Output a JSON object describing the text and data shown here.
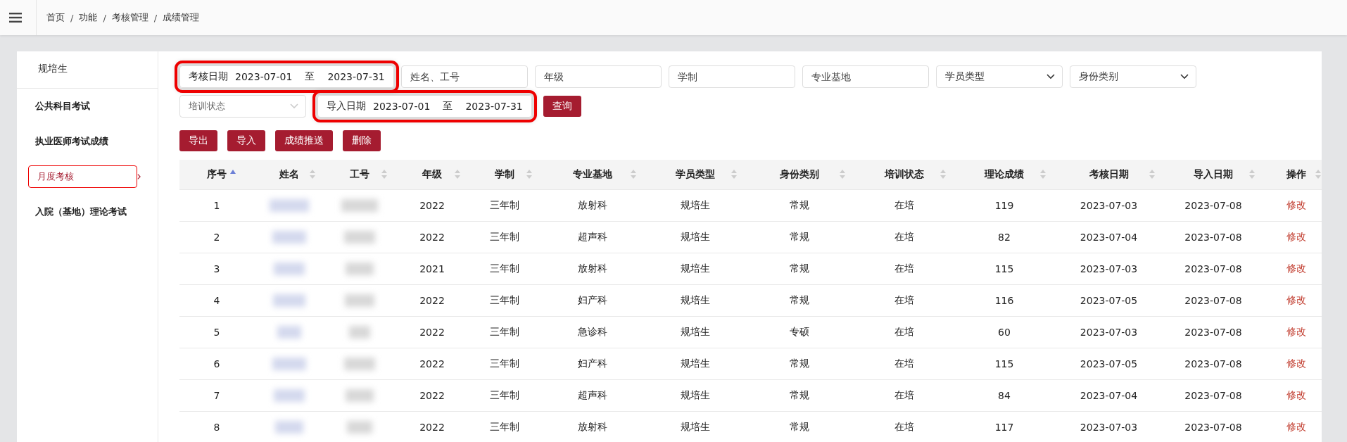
{
  "breadcrumb": [
    {
      "kind": "link",
      "text": "首页"
    },
    {
      "kind": "separator",
      "text": "/"
    },
    {
      "kind": "link",
      "text": "功能"
    },
    {
      "kind": "separator",
      "text": "/"
    },
    {
      "kind": "link",
      "text": "考核管理"
    },
    {
      "kind": "separator",
      "text": "/"
    },
    {
      "kind": "current",
      "text": "成绩管理"
    }
  ],
  "sidebar": {
    "title": "规培生",
    "items": [
      {
        "label": "公共科目考试",
        "selected": false,
        "highlighted": false
      },
      {
        "label": "执业医师考试成绩",
        "selected": false,
        "highlighted": false
      },
      {
        "label": "月度考核",
        "selected": true,
        "highlighted": true
      },
      {
        "label": "入院（基地）理论考试",
        "selected": false,
        "highlighted": false
      }
    ]
  },
  "filters": [
    {
      "kind": "range",
      "label": "考核日期",
      "from": "2023-07-01",
      "sep": "至",
      "to": "2023-07-31",
      "highlighted": true
    },
    {
      "kind": "input",
      "placeholder": "姓名、工号"
    },
    {
      "kind": "input",
      "placeholder": "年级"
    },
    {
      "kind": "input",
      "placeholder": "学制"
    },
    {
      "kind": "input",
      "placeholder": "专业基地"
    },
    {
      "kind": "select",
      "value": "学员类型",
      "muted": false
    },
    {
      "kind": "select",
      "value": "身份类别",
      "muted": false
    },
    {
      "kind": "select",
      "value": "培训状态",
      "muted": true
    },
    {
      "kind": "range",
      "label": "导入日期",
      "from": "2023-07-01",
      "sep": "至",
      "to": "2023-07-31",
      "highlighted": true
    },
    {
      "kind": "button",
      "label": "查询"
    }
  ],
  "actions": [
    "导出",
    "导入",
    "成绩推送",
    "删除"
  ],
  "table": {
    "columns": [
      {
        "label": "序号",
        "sorted": true
      },
      {
        "label": "姓名",
        "sorted": false
      },
      {
        "label": "工号",
        "sorted": false
      },
      {
        "label": "年级",
        "sorted": false
      },
      {
        "label": "学制",
        "sorted": false
      },
      {
        "label": "专业基地",
        "sorted": false
      },
      {
        "label": "学员类型",
        "sorted": false
      },
      {
        "label": "身份类别",
        "sorted": false
      },
      {
        "label": "培训状态",
        "sorted": false
      },
      {
        "label": "理论成绩",
        "sorted": false
      },
      {
        "label": "考核日期",
        "sorted": false
      },
      {
        "label": "导入日期",
        "sorted": false
      },
      {
        "label": "操作",
        "sorted": false
      }
    ],
    "rows": [
      {
        "no": "1",
        "grade": "2022",
        "system": "三年制",
        "base": "放射科",
        "type": "规培生",
        "identity": "常规",
        "status": "在培",
        "score": "119",
        "exam_date": "2023-07-03",
        "import_date": "2023-07-08",
        "action": "修改"
      },
      {
        "no": "2",
        "grade": "2022",
        "system": "三年制",
        "base": "超声科",
        "type": "规培生",
        "identity": "常规",
        "status": "在培",
        "score": "82",
        "exam_date": "2023-07-04",
        "import_date": "2023-07-08",
        "action": "修改"
      },
      {
        "no": "3",
        "grade": "2021",
        "system": "三年制",
        "base": "放射科",
        "type": "规培生",
        "identity": "常规",
        "status": "在培",
        "score": "115",
        "exam_date": "2023-07-03",
        "import_date": "2023-07-08",
        "action": "修改"
      },
      {
        "no": "4",
        "grade": "2022",
        "system": "三年制",
        "base": "妇产科",
        "type": "规培生",
        "identity": "常规",
        "status": "在培",
        "score": "116",
        "exam_date": "2023-07-05",
        "import_date": "2023-07-08",
        "action": "修改"
      },
      {
        "no": "5",
        "grade": "2022",
        "system": "三年制",
        "base": "急诊科",
        "type": "规培生",
        "identity": "专硕",
        "status": "在培",
        "score": "60",
        "exam_date": "2023-07-03",
        "import_date": "2023-07-08",
        "action": "修改"
      },
      {
        "no": "6",
        "grade": "2022",
        "system": "三年制",
        "base": "妇产科",
        "type": "规培生",
        "identity": "常规",
        "status": "在培",
        "score": "115",
        "exam_date": "2023-07-05",
        "import_date": "2023-07-08",
        "action": "修改"
      },
      {
        "no": "7",
        "grade": "2022",
        "system": "三年制",
        "base": "超声科",
        "type": "规培生",
        "identity": "常规",
        "status": "在培",
        "score": "84",
        "exam_date": "2023-07-04",
        "import_date": "2023-07-08",
        "action": "修改"
      },
      {
        "no": "8",
        "grade": "2022",
        "system": "三年制",
        "base": "放射科",
        "type": "规培生",
        "identity": "常规",
        "status": "在培",
        "score": "117",
        "exam_date": "2023-07-03",
        "import_date": "2023-07-08",
        "action": "修改"
      }
    ]
  }
}
